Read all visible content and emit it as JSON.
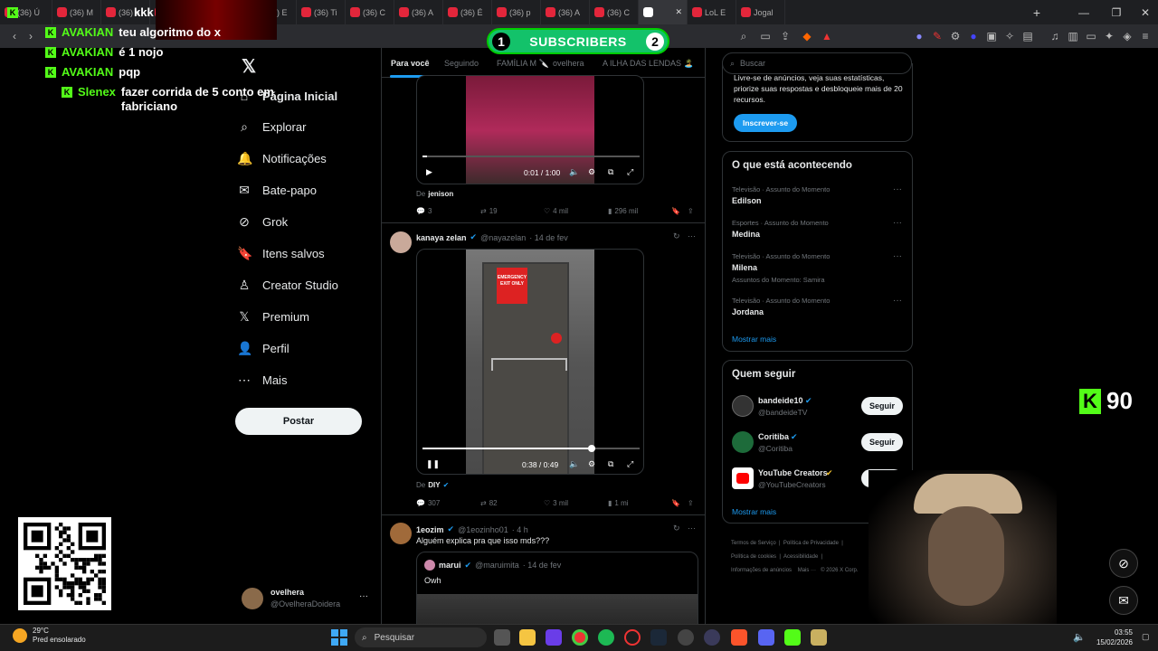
{
  "browser": {
    "tabs": [
      "(36) Ú",
      "(36) M",
      "(36) a",
      "(36) P",
      "(36) v",
      "(36) E",
      "(36) Ti",
      "(36) C",
      "(36) A",
      "(36) É",
      "(36) p",
      "(36) A",
      "(36) C",
      "",
      "LoL E",
      "Jogal"
    ],
    "active_tab_index": 13
  },
  "stream": {
    "subscribers_label": "SUBSCRIBERS",
    "sub_left": "1",
    "sub_right": "2",
    "viewer_count": "90",
    "chat": [
      {
        "user": "",
        "msg": "kkk"
      },
      {
        "user": "AVAKIAN",
        "msg": "teu algoritmo do x"
      },
      {
        "user": "AVAKIAN",
        "msg": "é 1 nojo"
      },
      {
        "user": "AVAKIAN",
        "msg": "pqp"
      },
      {
        "user": "Slenex",
        "msg": "fazer corrida de 5 conto em fabriciano"
      }
    ]
  },
  "sidebar": {
    "items": [
      {
        "label": "Página Inicial",
        "icon": "home-icon"
      },
      {
        "label": "Explorar",
        "icon": "search-icon"
      },
      {
        "label": "Notificações",
        "icon": "bell-icon"
      },
      {
        "label": "Bate-papo",
        "icon": "mail-icon"
      },
      {
        "label": "Grok",
        "icon": "grok-icon"
      },
      {
        "label": "Itens salvos",
        "icon": "bookmark-icon"
      },
      {
        "label": "Creator Studio",
        "icon": "creator-icon"
      },
      {
        "label": "Premium",
        "icon": "x-logo-icon"
      },
      {
        "label": "Perfil",
        "icon": "person-icon"
      },
      {
        "label": "Mais",
        "icon": "more-circle-icon"
      }
    ],
    "post_button": "Postar",
    "account_name": "ovelhera",
    "account_handle": "@OvelheraDoidera"
  },
  "feed": {
    "tabs": [
      "Para você",
      "Seguindo",
      "FAMÍLIA M 🔪",
      "ovelhera",
      "A ILHA DAS LENDAS 🏝️"
    ],
    "post1": {
      "time": "0:01 / 1:00",
      "progress": 0.02,
      "from_label": "De",
      "from": "jenison",
      "replies": "3",
      "reposts": "19",
      "likes": "4 mil",
      "views": "296 mil"
    },
    "post2": {
      "name": "kanaya zelan",
      "handle": "@nayazelan",
      "date": "· 14 de fev",
      "sign_text": "EMERGENCY EXIT ONLY",
      "time": "0:38 / 0:49",
      "progress": 0.78,
      "from_label": "De",
      "from": "DIY",
      "replies": "307",
      "reposts": "82",
      "likes": "3 mil",
      "views": "1 mi"
    },
    "post3": {
      "name": "1eozim",
      "handle": "@1eozinho01",
      "date": "· 4 h",
      "text": "Alguém explica pra que isso mds???",
      "quote_name": "marui",
      "quote_handle": "@maruimita",
      "quote_date": "· 14 de fev",
      "quote_text": "Owh"
    }
  },
  "right": {
    "search_placeholder": "Buscar",
    "premium_text": "Livre-se de anúncios, veja suas estatísticas, priorize suas respostas e desbloqueie mais de 20 recursos.",
    "premium_button": "Inscrever-se",
    "trends_title": "O que está acontecendo",
    "trends": [
      {
        "category": "Televisão · Assunto do Momento",
        "name": "Edilson",
        "extra": ""
      },
      {
        "category": "Esportes · Assunto do Momento",
        "name": "Medina",
        "extra": ""
      },
      {
        "category": "Televisão · Assunto do Momento",
        "name": "Milena",
        "extra": "Assuntos do Momento: Samira"
      },
      {
        "category": "Televisão · Assunto do Momento",
        "name": "Jordana",
        "extra": ""
      }
    ],
    "show_more": "Mostrar mais",
    "who_to_follow_title": "Quem seguir",
    "follows": [
      {
        "name": "bandeide10",
        "handle": "@bandeideTV",
        "button": "Seguir"
      },
      {
        "name": "Coritiba",
        "handle": "@Coritiba",
        "button": "Seguir"
      },
      {
        "name": "YouTube Creators",
        "handle": "@YouTubeCreators",
        "button": "Seguir"
      }
    ],
    "show_more_2": "Mostrar mais",
    "footer": [
      "Termos de Serviço",
      "Política de Privacidade",
      "Política de cookies",
      "Acessibilidade",
      "Informações de anúncios",
      "Mais ···",
      "© 2026 X Corp."
    ]
  },
  "taskbar": {
    "weather_temp": "29°C",
    "weather_desc": "Pred ensolarado",
    "search_label": "Pesquisar",
    "time": "03:55",
    "date": "15/02/2026"
  },
  "colors": {
    "accent": "#1d9bf0",
    "kick": "#53fc18",
    "subs": "#13c26a"
  }
}
